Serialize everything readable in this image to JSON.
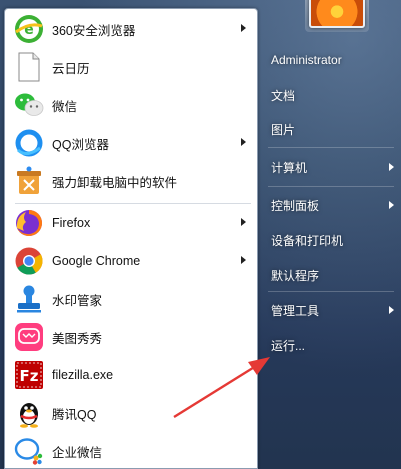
{
  "start_menu": {
    "programs": [
      {
        "label": "360安全浏览器",
        "icon": "360-browser-icon",
        "has_submenu": true
      },
      {
        "label": "云日历",
        "icon": "blank-document-icon",
        "has_submenu": false
      },
      {
        "label": "微信",
        "icon": "wechat-icon",
        "has_submenu": false
      },
      {
        "label": "QQ浏览器",
        "icon": "qq-browser-icon",
        "has_submenu": true
      },
      {
        "label": "强力卸载电脑中的软件",
        "icon": "uninstaller-icon",
        "has_submenu": false
      },
      {
        "label": "Firefox",
        "icon": "firefox-icon",
        "has_submenu": true
      },
      {
        "label": "Google Chrome",
        "icon": "chrome-icon",
        "has_submenu": true
      },
      {
        "label": "水印管家",
        "icon": "stamp-icon",
        "has_submenu": false
      },
      {
        "label": "美图秀秀",
        "icon": "meitu-icon",
        "has_submenu": false
      },
      {
        "label": "filezilla.exe",
        "icon": "filezilla-icon",
        "has_submenu": false
      },
      {
        "label": "腾讯QQ",
        "icon": "qq-penguin-icon",
        "has_submenu": false
      },
      {
        "label": "企业微信",
        "icon": "wecom-icon",
        "has_submenu": false
      }
    ],
    "right_links": [
      {
        "label": "Administrator",
        "has_submenu": false
      },
      {
        "label": "文档",
        "has_submenu": false
      },
      {
        "label": "图片",
        "has_submenu": false
      },
      {
        "label": "计算机",
        "has_submenu": true
      },
      {
        "label": "控制面板",
        "has_submenu": true
      },
      {
        "label": "设备和打印机",
        "has_submenu": false
      },
      {
        "label": "默认程序",
        "has_submenu": false
      },
      {
        "label": "管理工具",
        "has_submenu": true
      },
      {
        "label": "运行...",
        "has_submenu": false
      }
    ]
  },
  "colors": {
    "panel_bg": "#ffffff",
    "glass_bg": "#2d4462",
    "annotation_arrow": "#e53935"
  }
}
